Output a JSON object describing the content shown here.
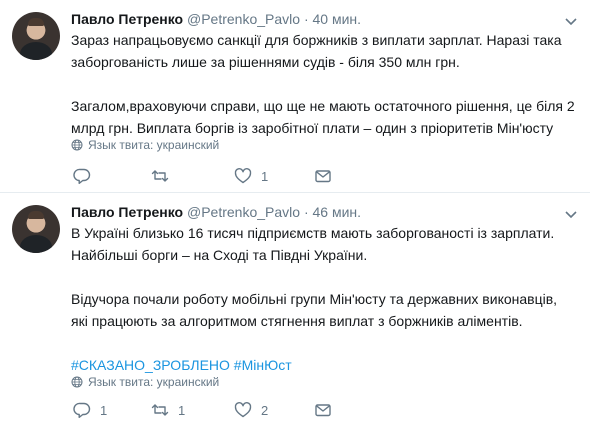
{
  "tweets": [
    {
      "name": "Павло Петренко",
      "handle": "@Petrenko_Pavlo",
      "separator": "·",
      "time": "40 мин.",
      "paragraphs": [
        "Зараз напрацьовуємо санкції для боржників з виплати зарплат. Наразі така заборгованість лише за рішеннями судів - біля 350 млн грн.",
        "Загалом,враховуючи справи, що ще не мають остаточного рішення, це біля 2 млрд грн. Виплата боргів із заробітної плати – один з пріоритетів Мін'юсту"
      ],
      "hashtags": "",
      "language": "Язык твита: украинский",
      "replies": "",
      "retweets": "",
      "likes": "1"
    },
    {
      "name": "Павло Петренко",
      "handle": "@Petrenko_Pavlo",
      "separator": "·",
      "time": "46 мин.",
      "paragraphs": [
        "В Україні близько 16 тисяч підприємств мають заборгованості із зарплати. Найбільші борги – на Сході та Півдні України.",
        "Відучора почали роботу мобільні групи Мін'юсту та державних виконавців, які працюють за алгоритмом стягнення виплат з боржників аліментів."
      ],
      "hashtags": "#СКАЗАНО_ЗРОБЛЕНО #МінЮст",
      "language": "Язык твита: украинский",
      "replies": "1",
      "retweets": "1",
      "likes": "2"
    }
  ]
}
